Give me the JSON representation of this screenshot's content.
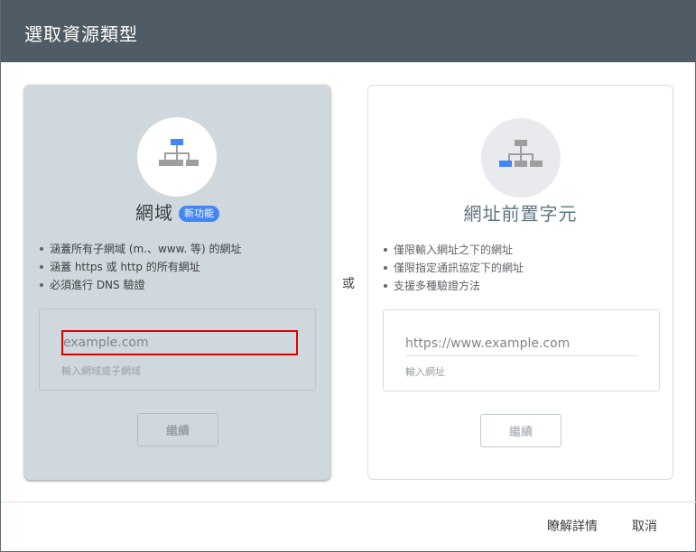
{
  "dialog": {
    "title": "選取資源類型",
    "or_label": "或"
  },
  "domain_card": {
    "heading": "網域",
    "badge": "新功能",
    "bullets": [
      "涵蓋所有子網域 (m.、www. 等) 的網址",
      "涵蓋 https 或 http 的所有網址",
      "必須進行 DNS 驗證"
    ],
    "input_placeholder": "example.com",
    "input_value": "",
    "helper": "輸入網域或子網域",
    "continue_label": "繼續",
    "icon": "sitemap-icon",
    "highlight_color": "#4285f4"
  },
  "prefix_card": {
    "heading": "網址前置字元",
    "bullets": [
      "僅限輸入網址之下的網址",
      "僅限指定通訊協定下的網址",
      "支援多種驗證方法"
    ],
    "input_placeholder": "https://www.example.com",
    "input_value": "",
    "helper": "輸入網址",
    "continue_label": "繼續",
    "icon": "sitemap-icon",
    "highlight_color": "#4285f4"
  },
  "footer": {
    "learn_more_label": "瞭解詳情",
    "cancel_label": "取消"
  },
  "colors": {
    "titlebar": "#4f5c66",
    "selected_card": "#cfd8dc",
    "badge": "#4285f4",
    "focus_outline": "#e00000"
  }
}
